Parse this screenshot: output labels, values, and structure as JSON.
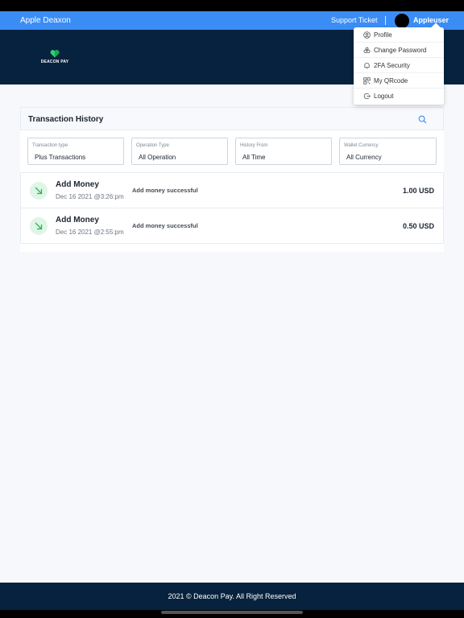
{
  "navbar": {
    "brand": "Apple Deaxon",
    "support_ticket": "Support Ticket",
    "username": "Appleuser"
  },
  "logo": {
    "text": "DEACON PAY"
  },
  "dropdown": {
    "items": [
      {
        "label": "Profile",
        "icon": "user-circle-icon"
      },
      {
        "label": "Change Password",
        "icon": "key-icon"
      },
      {
        "label": "2FA Security",
        "icon": "bell-icon"
      },
      {
        "label": "My QRcode",
        "icon": "qr-code-icon"
      },
      {
        "label": "Logout",
        "icon": "logout-icon"
      }
    ]
  },
  "card": {
    "title": "Transaction History",
    "filters": [
      {
        "label": "Transaction type",
        "value": "Plus Transactions"
      },
      {
        "label": "Operation Type",
        "value": "All Operation"
      },
      {
        "label": "History From",
        "value": "All Time"
      },
      {
        "label": "Wallet Currency",
        "value": "All Currency"
      }
    ],
    "transactions": [
      {
        "title": "Add Money",
        "date": "Dec 16 2021 @3:26:pm",
        "description": "Add money successful",
        "amount": "1.00 USD"
      },
      {
        "title": "Add Money",
        "date": "Dec 16 2021 @2:55:pm",
        "description": "Add money successful",
        "amount": "0.50 USD"
      }
    ]
  },
  "footer": {
    "text": "2021 © Deacon Pay. All Right Reserved"
  },
  "colors": {
    "accent": "#3b8df6",
    "dark_navy": "#07223e",
    "success_green": "#2bb35a"
  }
}
